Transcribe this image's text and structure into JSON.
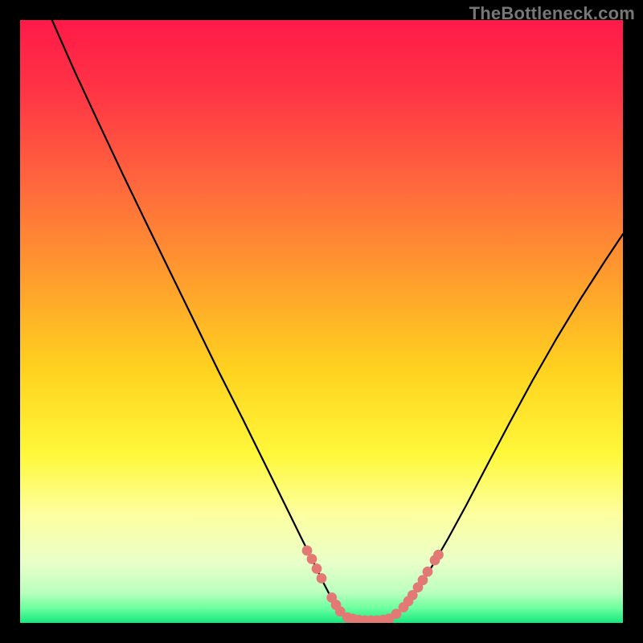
{
  "watermark": "TheBottleneck.com",
  "chart_data": {
    "type": "line",
    "title": "",
    "xlabel": "",
    "ylabel": "",
    "xlim": [
      0,
      1
    ],
    "ylim": [
      0,
      1
    ],
    "background_gradient": {
      "stops": [
        {
          "offset": 0.0,
          "color": "#ff1a48"
        },
        {
          "offset": 0.12,
          "color": "#ff3545"
        },
        {
          "offset": 0.28,
          "color": "#ff6a3c"
        },
        {
          "offset": 0.42,
          "color": "#ff9a2e"
        },
        {
          "offset": 0.58,
          "color": "#ffd21f"
        },
        {
          "offset": 0.72,
          "color": "#fff83a"
        },
        {
          "offset": 0.82,
          "color": "#fdffa0"
        },
        {
          "offset": 0.9,
          "color": "#e9ffc9"
        },
        {
          "offset": 0.95,
          "color": "#b9ffbe"
        },
        {
          "offset": 0.975,
          "color": "#6effa0"
        },
        {
          "offset": 1.0,
          "color": "#15e880"
        }
      ]
    },
    "series": [
      {
        "name": "left-curve",
        "stroke": "#000000",
        "stroke_width": 2.2,
        "points": [
          {
            "x": 0.053,
            "y": 1.0
          },
          {
            "x": 0.09,
            "y": 0.916
          },
          {
            "x": 0.13,
            "y": 0.83
          },
          {
            "x": 0.17,
            "y": 0.745
          },
          {
            "x": 0.21,
            "y": 0.662
          },
          {
            "x": 0.25,
            "y": 0.58
          },
          {
            "x": 0.29,
            "y": 0.498
          },
          {
            "x": 0.33,
            "y": 0.416
          },
          {
            "x": 0.37,
            "y": 0.337
          },
          {
            "x": 0.408,
            "y": 0.26
          },
          {
            "x": 0.44,
            "y": 0.195
          },
          {
            "x": 0.466,
            "y": 0.142
          },
          {
            "x": 0.488,
            "y": 0.098
          },
          {
            "x": 0.504,
            "y": 0.065
          },
          {
            "x": 0.517,
            "y": 0.04
          },
          {
            "x": 0.528,
            "y": 0.024
          },
          {
            "x": 0.54,
            "y": 0.012
          },
          {
            "x": 0.552,
            "y": 0.006
          },
          {
            "x": 0.568,
            "y": 0.004
          },
          {
            "x": 0.585,
            "y": 0.004
          },
          {
            "x": 0.602,
            "y": 0.005
          },
          {
            "x": 0.618,
            "y": 0.01
          },
          {
            "x": 0.633,
            "y": 0.022
          },
          {
            "x": 0.648,
            "y": 0.04
          },
          {
            "x": 0.664,
            "y": 0.063
          },
          {
            "x": 0.684,
            "y": 0.095
          },
          {
            "x": 0.71,
            "y": 0.14
          },
          {
            "x": 0.74,
            "y": 0.195
          },
          {
            "x": 0.775,
            "y": 0.262
          },
          {
            "x": 0.812,
            "y": 0.332
          },
          {
            "x": 0.85,
            "y": 0.402
          },
          {
            "x": 0.89,
            "y": 0.472
          },
          {
            "x": 0.93,
            "y": 0.538
          },
          {
            "x": 0.97,
            "y": 0.6
          },
          {
            "x": 1.0,
            "y": 0.645
          }
        ]
      }
    ],
    "markers": {
      "color": "#e27974",
      "radius_norm": 0.0085,
      "points": [
        {
          "x": 0.476,
          "y": 0.12
        },
        {
          "x": 0.484,
          "y": 0.106
        },
        {
          "x": 0.492,
          "y": 0.09
        },
        {
          "x": 0.5,
          "y": 0.074
        },
        {
          "x": 0.517,
          "y": 0.042
        },
        {
          "x": 0.524,
          "y": 0.03
        },
        {
          "x": 0.531,
          "y": 0.019
        },
        {
          "x": 0.543,
          "y": 0.009
        },
        {
          "x": 0.552,
          "y": 0.007
        },
        {
          "x": 0.562,
          "y": 0.005
        },
        {
          "x": 0.572,
          "y": 0.004
        },
        {
          "x": 0.582,
          "y": 0.004
        },
        {
          "x": 0.592,
          "y": 0.004
        },
        {
          "x": 0.602,
          "y": 0.005
        },
        {
          "x": 0.612,
          "y": 0.007
        },
        {
          "x": 0.624,
          "y": 0.015
        },
        {
          "x": 0.636,
          "y": 0.026
        },
        {
          "x": 0.644,
          "y": 0.036
        },
        {
          "x": 0.651,
          "y": 0.046
        },
        {
          "x": 0.66,
          "y": 0.059
        },
        {
          "x": 0.668,
          "y": 0.071
        },
        {
          "x": 0.676,
          "y": 0.085
        },
        {
          "x": 0.688,
          "y": 0.104
        },
        {
          "x": 0.694,
          "y": 0.113
        }
      ]
    }
  }
}
